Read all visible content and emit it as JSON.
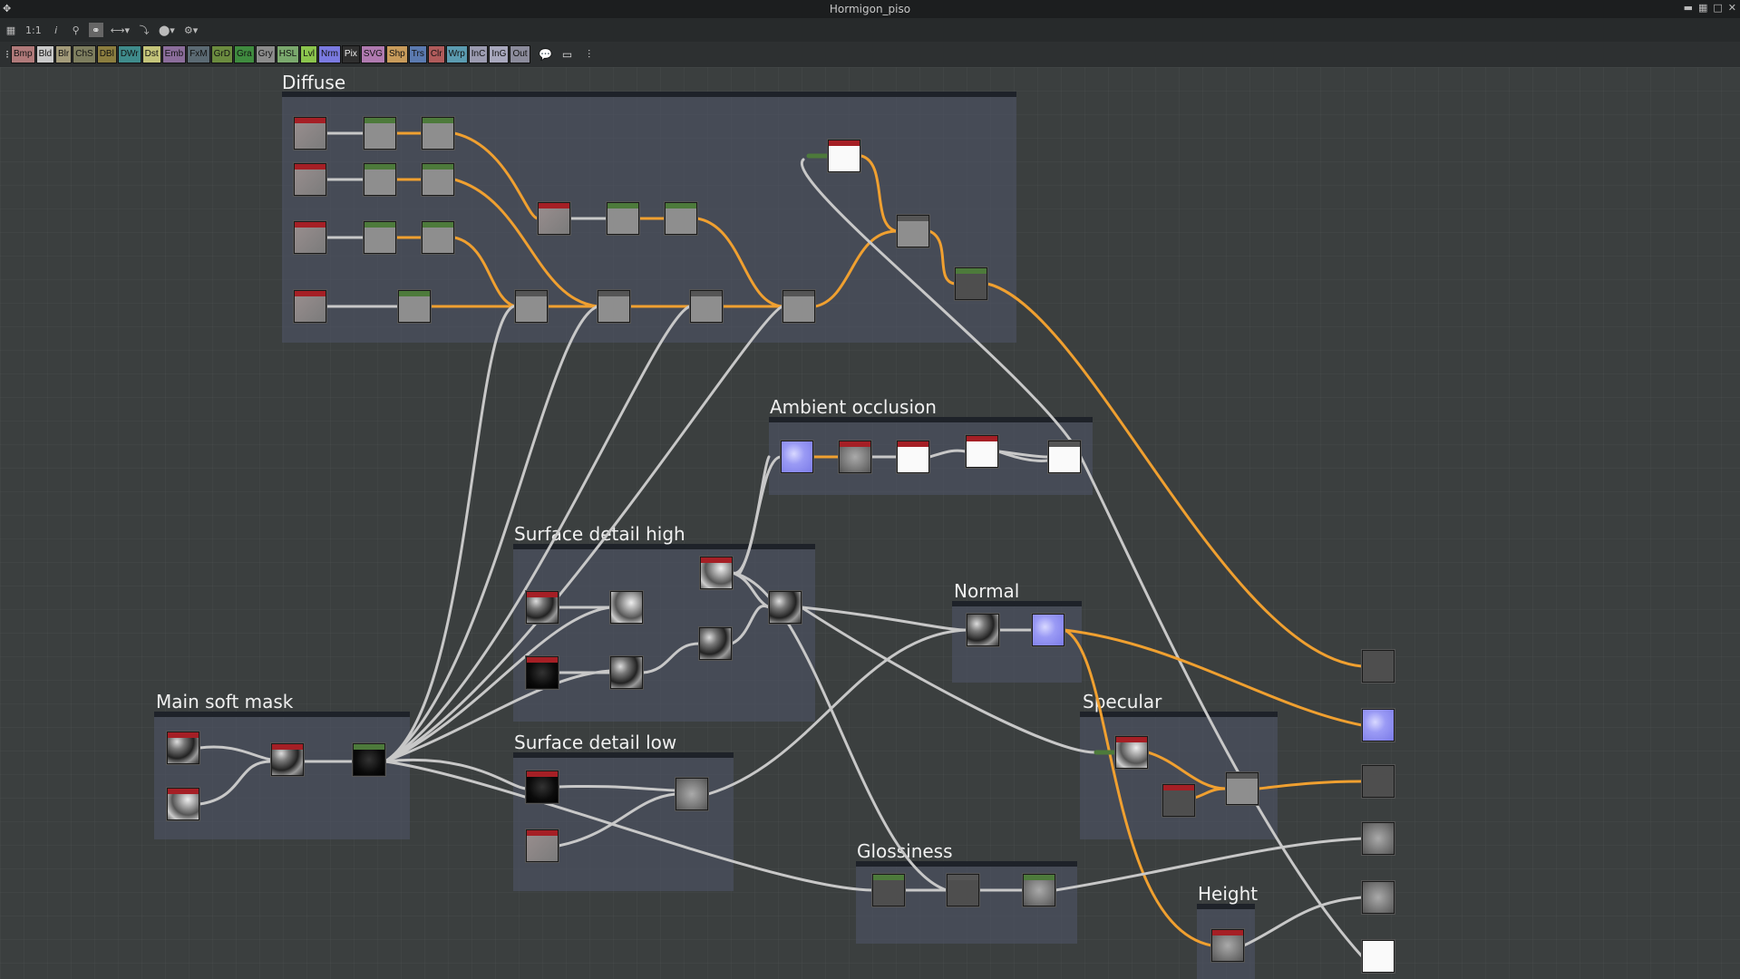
{
  "window": {
    "title": "Hormigon_piso"
  },
  "toolbar": {
    "zoom_label": "1:1",
    "info_label": "i"
  },
  "library": [
    {
      "label": "Bmp",
      "color": "#b07a7a"
    },
    {
      "label": "Bld",
      "color": "#c9c9c9"
    },
    {
      "label": "Blr",
      "color": "#a39b7a"
    },
    {
      "label": "ChS",
      "color": "#7d7d5e"
    },
    {
      "label": "DBl",
      "color": "#8b7d3f"
    },
    {
      "label": "DWr",
      "color": "#3f8b8b"
    },
    {
      "label": "Dst",
      "color": "#c4c47a"
    },
    {
      "label": "Emb",
      "color": "#8b6d9b"
    },
    {
      "label": "FxM",
      "color": "#5b6a73"
    },
    {
      "label": "GrD",
      "color": "#6b8b3f"
    },
    {
      "label": "Gra",
      "color": "#3f8b3f"
    },
    {
      "label": "Gry",
      "color": "#8b8b8b"
    },
    {
      "label": "HSL",
      "color": "#7aa86d"
    },
    {
      "label": "Lvl",
      "color": "#8bc44d"
    },
    {
      "label": "Nrm",
      "color": "#7a7ae0"
    },
    {
      "label": "Pix",
      "color": "#2f2f2f"
    },
    {
      "label": "SVG",
      "color": "#b07ab0"
    },
    {
      "label": "Shp",
      "color": "#c89b5b"
    },
    {
      "label": "Trs",
      "color": "#5b7ab0"
    },
    {
      "label": "Clr",
      "color": "#b05b5b"
    },
    {
      "label": "Wrp",
      "color": "#5b9bb0"
    },
    {
      "label": "InC",
      "color": "#9b9bb0"
    },
    {
      "label": "InG",
      "color": "#a8a8bd"
    },
    {
      "label": "Out",
      "color": "#8b8b9b"
    }
  ],
  "frames": [
    {
      "id": "diffuse",
      "title": "Diffuse"
    },
    {
      "id": "ao",
      "title": "Ambient occlusion"
    },
    {
      "id": "sdh",
      "title": "Surface detail high"
    },
    {
      "id": "normal",
      "title": "Normal"
    },
    {
      "id": "msm",
      "title": "Main soft mask"
    },
    {
      "id": "spec",
      "title": "Specular"
    },
    {
      "id": "sdl",
      "title": "Surface detail low"
    },
    {
      "id": "gloss",
      "title": "Glossiness"
    },
    {
      "id": "height",
      "title": "Height"
    }
  ],
  "colors": {
    "wire_color": "#f0a030",
    "wire_gray": "#c8c8c8",
    "frame_bg": "#4e5264",
    "canvas_bg": "#3b3f3f"
  }
}
